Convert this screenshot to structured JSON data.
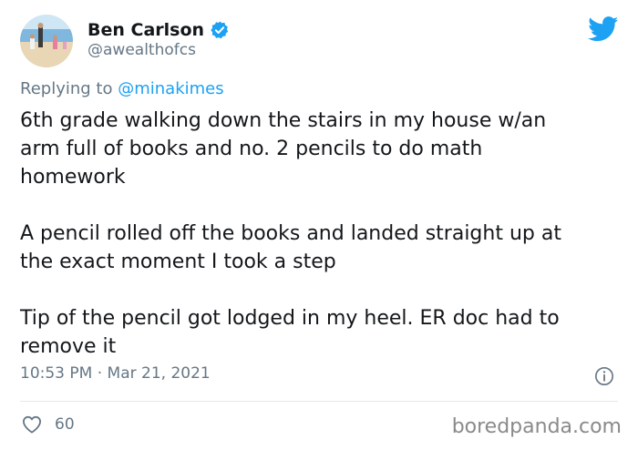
{
  "author": {
    "display_name": "Ben Carlson",
    "handle": "@awealthofcs",
    "verified": true
  },
  "reply": {
    "prefix": "Replying to",
    "to": "@minakimes"
  },
  "tweet": {
    "paragraphs": [
      "6th grade walking down the stairs in my house w/an\narm full of books and no. 2 pencils to do math\nhomework",
      "A pencil rolled off the books and landed straight up at\nthe exact moment I took a step",
      "Tip of the pencil got lodged in my heel. ER doc had to\nremove it"
    ],
    "timestamp": "10:53 PM · Mar 21, 2021",
    "likes": "60"
  },
  "watermark": "boredpanda.com",
  "colors": {
    "twitter_blue": "#1da1f2",
    "secondary_text": "#657786",
    "divider": "#e1e8ed"
  },
  "icons": {
    "verified": "verified-badge-icon",
    "logo": "twitter-bird-icon",
    "info": "info-icon",
    "like": "heart-icon"
  }
}
